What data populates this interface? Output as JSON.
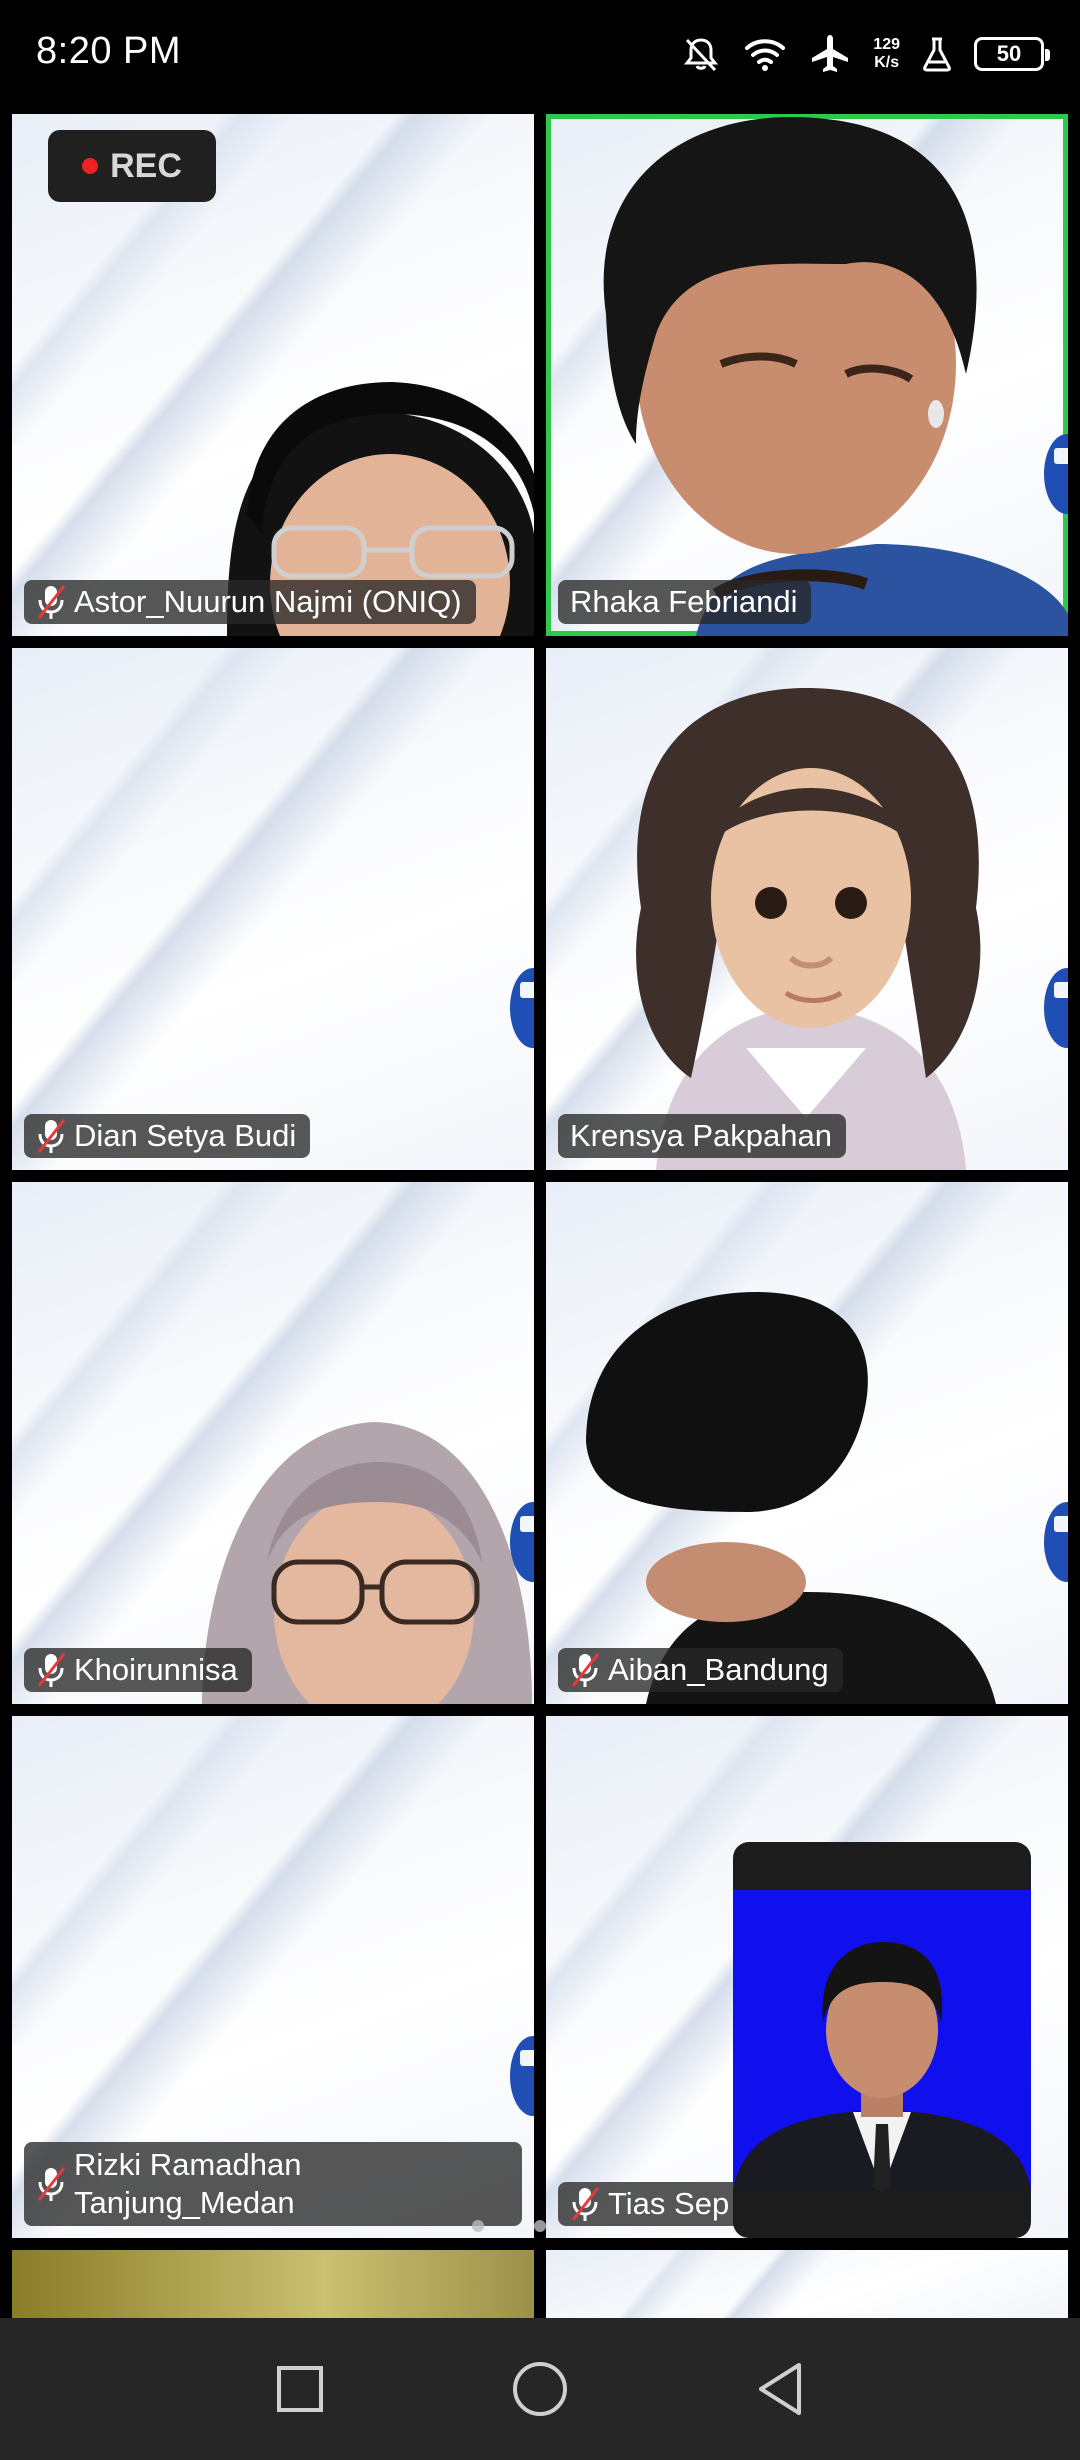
{
  "status_bar": {
    "time": "8:20 PM",
    "net_speed_value": "129",
    "net_speed_unit": "K/s",
    "battery": "50",
    "icons": [
      "do-not-disturb-icon",
      "wifi-icon",
      "airplane-icon",
      "lab-icon",
      "battery-icon"
    ]
  },
  "recording": {
    "label": "REC",
    "dot_color": "#ee2222"
  },
  "participants": [
    {
      "name": "Astor_Nuurun Najmi (ONIQ)",
      "muted": true
    },
    {
      "name": "Rhaka Febriandi",
      "muted": false,
      "active_speaker": true
    },
    {
      "name": "Dian Setya Budi",
      "muted": true
    },
    {
      "name": "Krensya Pakpahan",
      "muted": false
    },
    {
      "name": "Khoirunnisa",
      "muted": true
    },
    {
      "name": "Aiban_Bandung",
      "muted": true
    },
    {
      "name": "Rizki Ramadhan Tanjung_Medan",
      "muted": true
    },
    {
      "name": "Tias Sep",
      "muted": true
    }
  ],
  "colors": {
    "active_border": "#2ec84a",
    "label_bg": "#282828",
    "nav_bar": "#262626",
    "self_view_bg": "#1010ee"
  },
  "nav": {
    "buttons": [
      "recents-square-icon",
      "home-circle-icon",
      "back-triangle-icon"
    ]
  }
}
